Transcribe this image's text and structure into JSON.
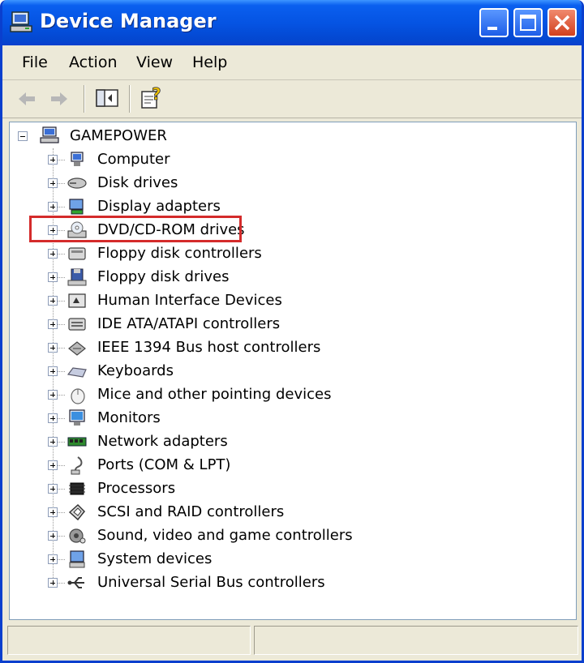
{
  "window": {
    "title": "Device Manager",
    "accent": "#0A3FCE"
  },
  "menu": [
    "File",
    "Action",
    "View",
    "Help"
  ],
  "toolbar": {
    "icons": [
      "back-arrow-icon",
      "forward-arrow-icon",
      "show-hide-tree-icon",
      "help-icon"
    ]
  },
  "tree": {
    "root": {
      "label": "GAMEPOWER",
      "icon": "computer-icon"
    },
    "items": [
      {
        "label": "Computer",
        "icon": "computer-icon"
      },
      {
        "label": "Disk drives",
        "icon": "disk-drive-icon"
      },
      {
        "label": "Display adapters",
        "icon": "display-adapter-icon"
      },
      {
        "label": "DVD/CD-ROM drives",
        "icon": "cd-rom-icon",
        "highlighted": true
      },
      {
        "label": "Floppy disk controllers",
        "icon": "floppy-controller-icon"
      },
      {
        "label": "Floppy disk drives",
        "icon": "floppy-drive-icon"
      },
      {
        "label": "Human Interface Devices",
        "icon": "hid-icon"
      },
      {
        "label": "IDE ATA/ATAPI controllers",
        "icon": "ide-controller-icon"
      },
      {
        "label": "IEEE 1394 Bus host controllers",
        "icon": "ieee1394-icon"
      },
      {
        "label": "Keyboards",
        "icon": "keyboard-icon"
      },
      {
        "label": "Mice and other pointing devices",
        "icon": "mouse-icon"
      },
      {
        "label": "Monitors",
        "icon": "monitor-icon"
      },
      {
        "label": "Network adapters",
        "icon": "network-adapter-icon"
      },
      {
        "label": "Ports (COM & LPT)",
        "icon": "port-icon"
      },
      {
        "label": "Processors",
        "icon": "processor-icon"
      },
      {
        "label": "SCSI and RAID controllers",
        "icon": "scsi-icon"
      },
      {
        "label": "Sound, video and game controllers",
        "icon": "sound-icon"
      },
      {
        "label": "System devices",
        "icon": "system-device-icon"
      },
      {
        "label": "Universal Serial Bus controllers",
        "icon": "usb-icon"
      }
    ]
  },
  "highlight_color": "#D42B2B"
}
